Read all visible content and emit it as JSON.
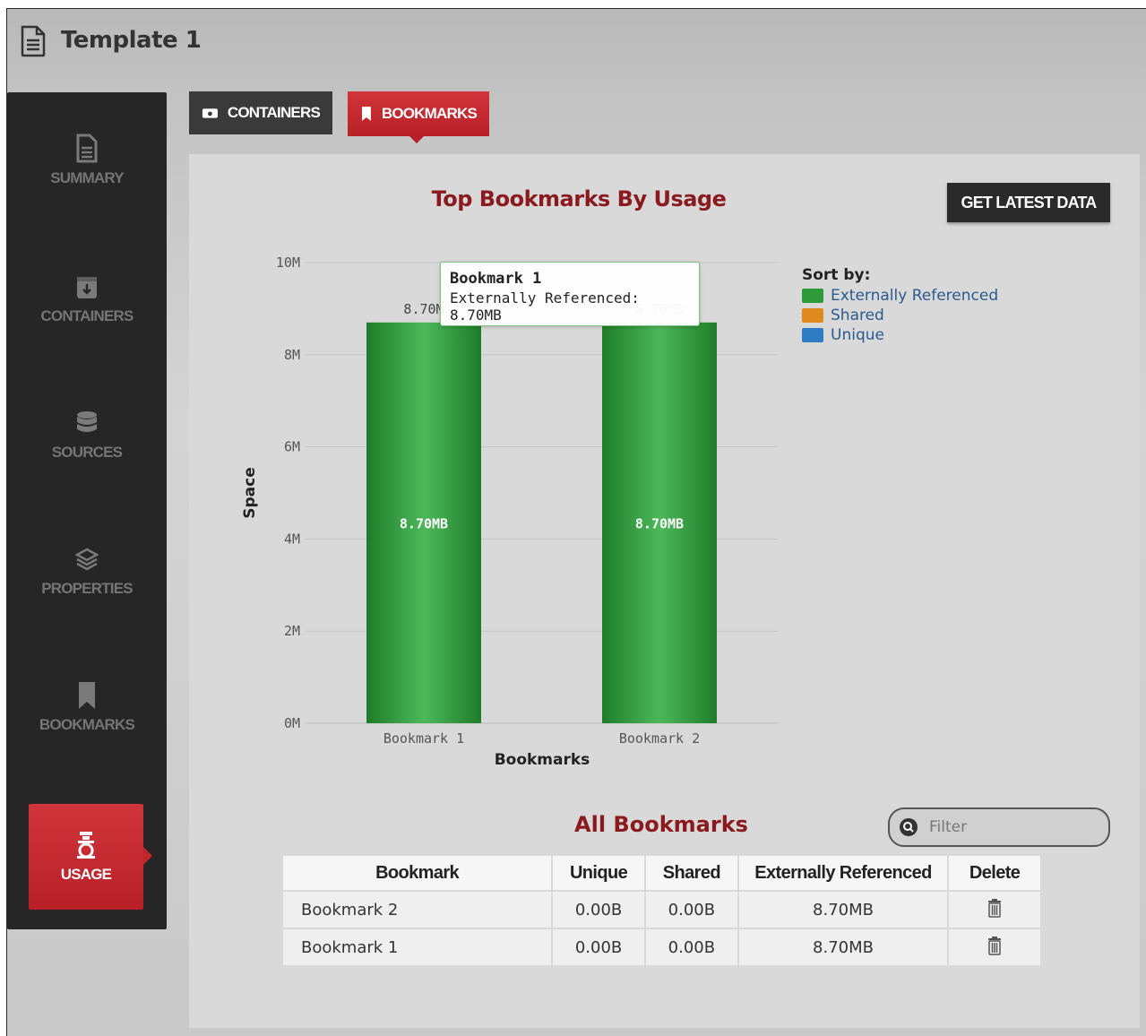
{
  "header": {
    "title": "Template 1"
  },
  "sidebar": {
    "items": [
      {
        "label": "SUMMARY",
        "icon": "document-icon"
      },
      {
        "label": "CONTAINERS",
        "icon": "container-icon"
      },
      {
        "label": "SOURCES",
        "icon": "database-icon"
      },
      {
        "label": "PROPERTIES",
        "icon": "layers-icon"
      },
      {
        "label": "BOOKMARKS",
        "icon": "bookmark-icon"
      },
      {
        "label": "USAGE",
        "icon": "usage-icon",
        "active": true
      }
    ]
  },
  "tabs": [
    {
      "label": "CONTAINERS",
      "icon": "container-icon"
    },
    {
      "label": "BOOKMARKS",
      "icon": "bookmark-icon",
      "active": true
    }
  ],
  "toolbar": {
    "get_data_label": "GET LATEST DATA"
  },
  "colors": {
    "accent_red": "#c0252c",
    "title_red": "#8b1a1f",
    "bar_green": "#2e9b3a",
    "legend_orange": "#e08a1e",
    "legend_blue": "#2f7cc4"
  },
  "chart_data": {
    "type": "bar",
    "title": "Top Bookmarks By Usage",
    "xlabel": "Bookmarks",
    "ylabel": "Space",
    "categories": [
      "Bookmark 1",
      "Bookmark 2"
    ],
    "series": [
      {
        "name": "Externally Referenced",
        "values": [
          8.7,
          8.7
        ],
        "labels": [
          "8.70MB",
          "8.70MB"
        ]
      }
    ],
    "top_labels": [
      "8.70M",
      "8.70MB"
    ],
    "ylim": [
      0,
      10
    ],
    "yticks": [
      "0M",
      "2M",
      "4M",
      "6M",
      "8M",
      "10M"
    ],
    "grid": true,
    "legend": {
      "title": "Sort by:",
      "placement": "right",
      "items": [
        {
          "label": "Externally Referenced",
          "color": "#2e9b3a"
        },
        {
          "label": "Shared",
          "color": "#e08a1e"
        },
        {
          "label": "Unique",
          "color": "#2f7cc4"
        }
      ]
    },
    "tooltip": {
      "title": "Bookmark 1",
      "body": "Externally Referenced: 8.70MB"
    }
  },
  "table": {
    "title": "All Bookmarks",
    "filter_placeholder": "Filter",
    "columns": [
      "Bookmark",
      "Unique",
      "Shared",
      "Externally Referenced",
      "Delete"
    ],
    "rows": [
      {
        "name": "Bookmark 2",
        "unique": "0.00B",
        "shared": "0.00B",
        "external": "8.70MB"
      },
      {
        "name": "Bookmark 1",
        "unique": "0.00B",
        "shared": "0.00B",
        "external": "8.70MB"
      }
    ]
  }
}
